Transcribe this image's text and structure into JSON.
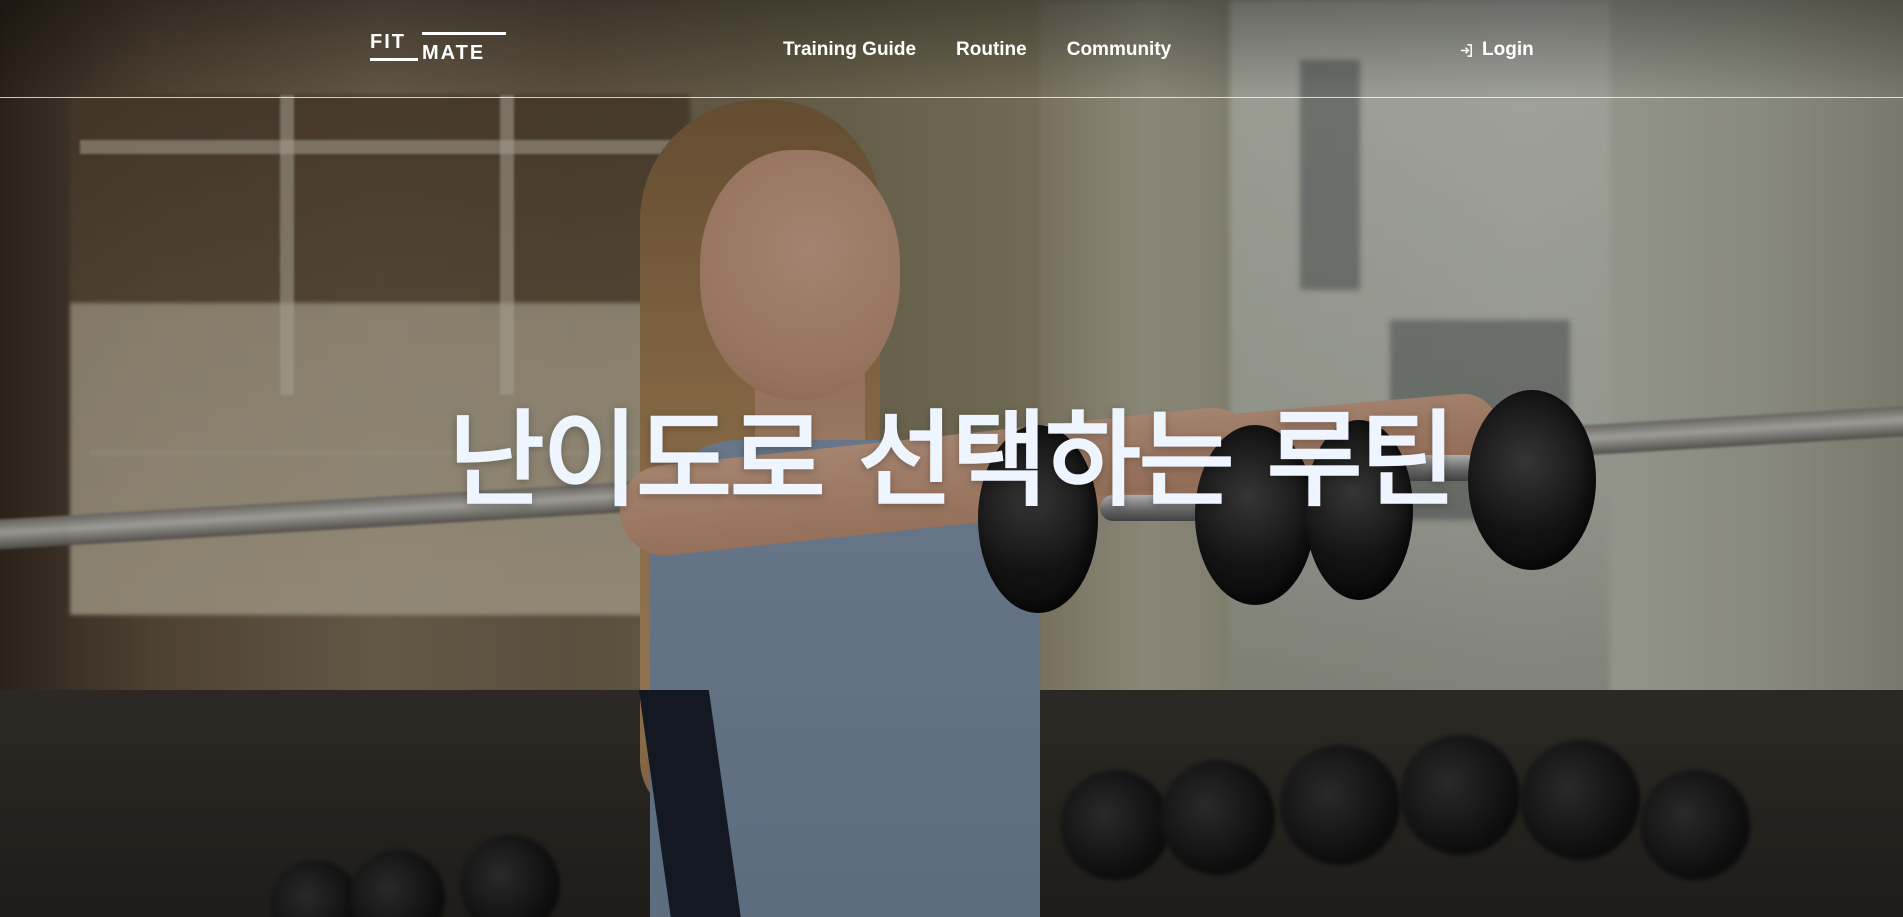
{
  "brand": {
    "logo_top": "FIT",
    "logo_bottom": "MATE"
  },
  "nav": {
    "items": [
      {
        "label": "Training Guide"
      },
      {
        "label": "Routine"
      },
      {
        "label": "Community"
      }
    ],
    "login_label": "Login",
    "login_icon": "login-arrow-icon"
  },
  "hero": {
    "title": "난이도로 선택하는 루틴",
    "background_image": "woman lifting dumbbells in gym"
  },
  "colors": {
    "text_primary": "#ffffff",
    "hero_title": "#eef5ff",
    "header_border": "#ffffff"
  }
}
